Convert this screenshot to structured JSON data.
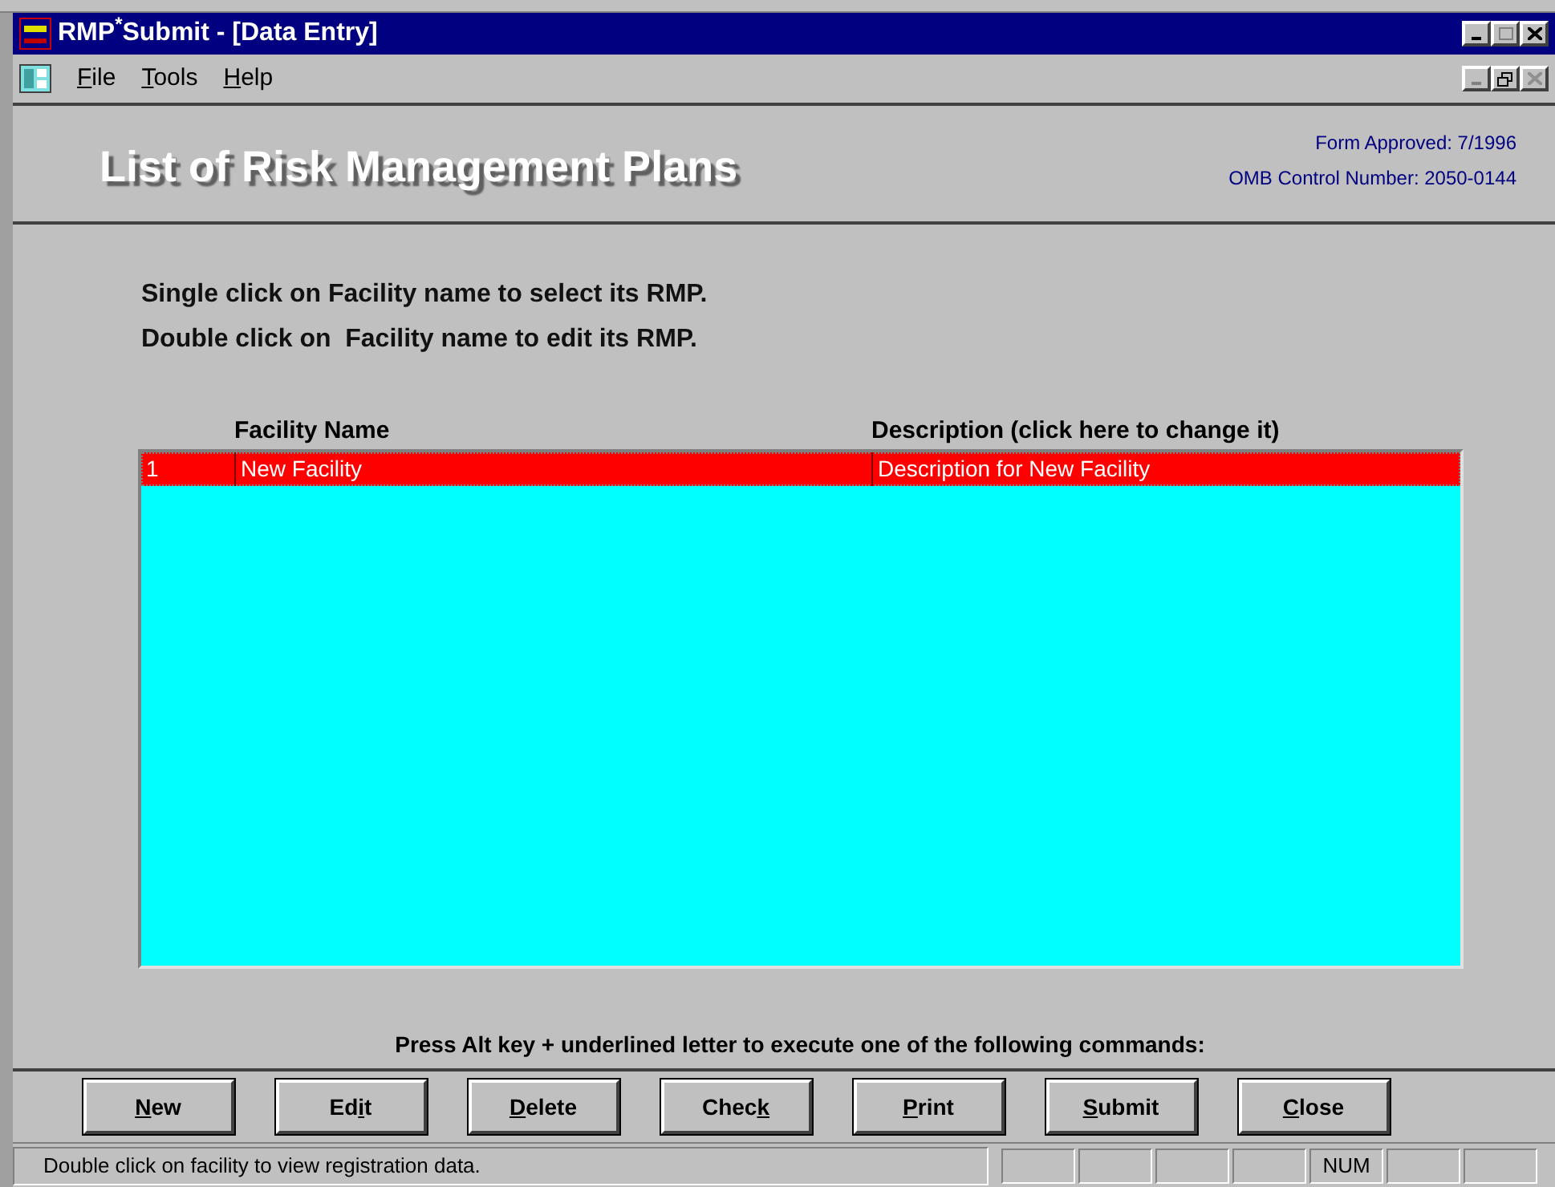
{
  "window": {
    "title": "RMP$^{*}$Submit - [Data Entry]"
  },
  "menu": [
    {
      "key": "F",
      "post": "ile"
    },
    {
      "key": "T",
      "post": "ools"
    },
    {
      "key": "H",
      "post": "elp"
    }
  ],
  "header": {
    "title": "List of Risk Management Plans",
    "form_approved": "Form Approved: 7/1996",
    "omb": "OMB Control Number: 2050-0144"
  },
  "instructions": [
    "Single click on Facility name to select its RMP.",
    "Double click on  Facility name to edit its RMP."
  ],
  "table": {
    "columns": [
      "Facility Name",
      "Description (click here to change it)"
    ],
    "rows": [
      {
        "index": "1",
        "name": "New Facility",
        "description": "Description for New Facility",
        "selected": true
      }
    ]
  },
  "hint": "Press Alt key + underlined letter to execute one of the following commands:",
  "buttons": [
    {
      "key": "N",
      "post": "ew"
    },
    {
      "pre": "Ed",
      "key": "i",
      "post": "t"
    },
    {
      "key": "D",
      "post": "elete"
    },
    {
      "pre": "Chec",
      "key": "k"
    },
    {
      "key": "P",
      "post": "rint"
    },
    {
      "key": "S",
      "post": "ubmit"
    },
    {
      "key": "C",
      "post": "lose"
    }
  ],
  "status_bar": {
    "message": "Double click on facility to view registration data.",
    "indicator": "NUM"
  }
}
